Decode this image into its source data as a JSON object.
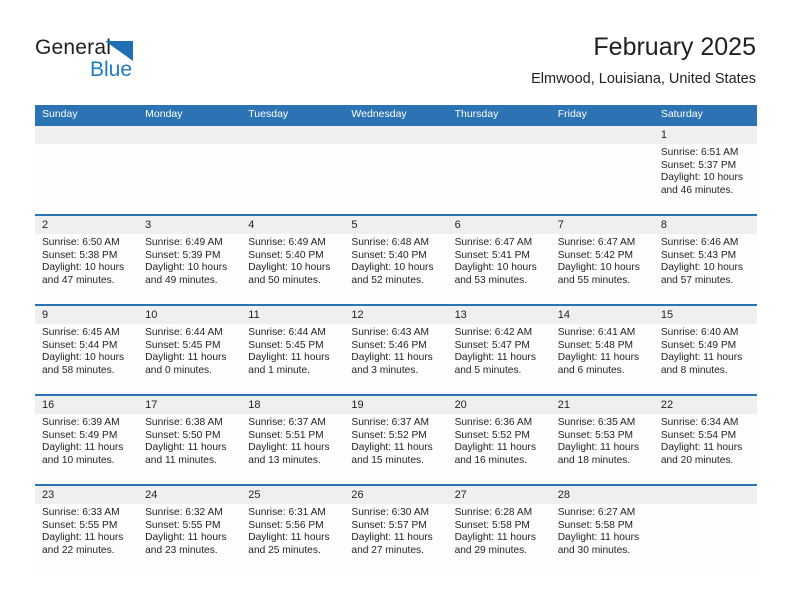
{
  "logo": {
    "word_one": "General",
    "word_two": "Blue",
    "triangle_color": "#1f6fb5",
    "blue_color": "#1f7bc1"
  },
  "header": {
    "title": "February 2025",
    "subtitle": "Elmwood, Louisiana, United States",
    "accent_color": "#2c73b4"
  },
  "calendar": {
    "weekdays": [
      "Sunday",
      "Monday",
      "Tuesday",
      "Wednesday",
      "Thursday",
      "Friday",
      "Saturday"
    ],
    "weeks": [
      [
        {
          "day": "",
          "sunrise": "",
          "sunset": "",
          "daylight": "",
          "empty": true
        },
        {
          "day": "",
          "sunrise": "",
          "sunset": "",
          "daylight": "",
          "empty": true
        },
        {
          "day": "",
          "sunrise": "",
          "sunset": "",
          "daylight": "",
          "empty": true
        },
        {
          "day": "",
          "sunrise": "",
          "sunset": "",
          "daylight": "",
          "empty": true
        },
        {
          "day": "",
          "sunrise": "",
          "sunset": "",
          "daylight": "",
          "empty": true
        },
        {
          "day": "",
          "sunrise": "",
          "sunset": "",
          "daylight": "",
          "empty": true
        },
        {
          "day": "1",
          "sunrise": "Sunrise: 6:51 AM",
          "sunset": "Sunset: 5:37 PM",
          "daylight": "Daylight: 10 hours and 46 minutes.",
          "empty": false
        }
      ],
      [
        {
          "day": "2",
          "sunrise": "Sunrise: 6:50 AM",
          "sunset": "Sunset: 5:38 PM",
          "daylight": "Daylight: 10 hours and 47 minutes.",
          "empty": false
        },
        {
          "day": "3",
          "sunrise": "Sunrise: 6:49 AM",
          "sunset": "Sunset: 5:39 PM",
          "daylight": "Daylight: 10 hours and 49 minutes.",
          "empty": false
        },
        {
          "day": "4",
          "sunrise": "Sunrise: 6:49 AM",
          "sunset": "Sunset: 5:40 PM",
          "daylight": "Daylight: 10 hours and 50 minutes.",
          "empty": false
        },
        {
          "day": "5",
          "sunrise": "Sunrise: 6:48 AM",
          "sunset": "Sunset: 5:40 PM",
          "daylight": "Daylight: 10 hours and 52 minutes.",
          "empty": false
        },
        {
          "day": "6",
          "sunrise": "Sunrise: 6:47 AM",
          "sunset": "Sunset: 5:41 PM",
          "daylight": "Daylight: 10 hours and 53 minutes.",
          "empty": false
        },
        {
          "day": "7",
          "sunrise": "Sunrise: 6:47 AM",
          "sunset": "Sunset: 5:42 PM",
          "daylight": "Daylight: 10 hours and 55 minutes.",
          "empty": false
        },
        {
          "day": "8",
          "sunrise": "Sunrise: 6:46 AM",
          "sunset": "Sunset: 5:43 PM",
          "daylight": "Daylight: 10 hours and 57 minutes.",
          "empty": false
        }
      ],
      [
        {
          "day": "9",
          "sunrise": "Sunrise: 6:45 AM",
          "sunset": "Sunset: 5:44 PM",
          "daylight": "Daylight: 10 hours and 58 minutes.",
          "empty": false
        },
        {
          "day": "10",
          "sunrise": "Sunrise: 6:44 AM",
          "sunset": "Sunset: 5:45 PM",
          "daylight": "Daylight: 11 hours and 0 minutes.",
          "empty": false
        },
        {
          "day": "11",
          "sunrise": "Sunrise: 6:44 AM",
          "sunset": "Sunset: 5:45 PM",
          "daylight": "Daylight: 11 hours and 1 minute.",
          "empty": false
        },
        {
          "day": "12",
          "sunrise": "Sunrise: 6:43 AM",
          "sunset": "Sunset: 5:46 PM",
          "daylight": "Daylight: 11 hours and 3 minutes.",
          "empty": false
        },
        {
          "day": "13",
          "sunrise": "Sunrise: 6:42 AM",
          "sunset": "Sunset: 5:47 PM",
          "daylight": "Daylight: 11 hours and 5 minutes.",
          "empty": false
        },
        {
          "day": "14",
          "sunrise": "Sunrise: 6:41 AM",
          "sunset": "Sunset: 5:48 PM",
          "daylight": "Daylight: 11 hours and 6 minutes.",
          "empty": false
        },
        {
          "day": "15",
          "sunrise": "Sunrise: 6:40 AM",
          "sunset": "Sunset: 5:49 PM",
          "daylight": "Daylight: 11 hours and 8 minutes.",
          "empty": false
        }
      ],
      [
        {
          "day": "16",
          "sunrise": "Sunrise: 6:39 AM",
          "sunset": "Sunset: 5:49 PM",
          "daylight": "Daylight: 11 hours and 10 minutes.",
          "empty": false
        },
        {
          "day": "17",
          "sunrise": "Sunrise: 6:38 AM",
          "sunset": "Sunset: 5:50 PM",
          "daylight": "Daylight: 11 hours and 11 minutes.",
          "empty": false
        },
        {
          "day": "18",
          "sunrise": "Sunrise: 6:37 AM",
          "sunset": "Sunset: 5:51 PM",
          "daylight": "Daylight: 11 hours and 13 minutes.",
          "empty": false
        },
        {
          "day": "19",
          "sunrise": "Sunrise: 6:37 AM",
          "sunset": "Sunset: 5:52 PM",
          "daylight": "Daylight: 11 hours and 15 minutes.",
          "empty": false
        },
        {
          "day": "20",
          "sunrise": "Sunrise: 6:36 AM",
          "sunset": "Sunset: 5:52 PM",
          "daylight": "Daylight: 11 hours and 16 minutes.",
          "empty": false
        },
        {
          "day": "21",
          "sunrise": "Sunrise: 6:35 AM",
          "sunset": "Sunset: 5:53 PM",
          "daylight": "Daylight: 11 hours and 18 minutes.",
          "empty": false
        },
        {
          "day": "22",
          "sunrise": "Sunrise: 6:34 AM",
          "sunset": "Sunset: 5:54 PM",
          "daylight": "Daylight: 11 hours and 20 minutes.",
          "empty": false
        }
      ],
      [
        {
          "day": "23",
          "sunrise": "Sunrise: 6:33 AM",
          "sunset": "Sunset: 5:55 PM",
          "daylight": "Daylight: 11 hours and 22 minutes.",
          "empty": false
        },
        {
          "day": "24",
          "sunrise": "Sunrise: 6:32 AM",
          "sunset": "Sunset: 5:55 PM",
          "daylight": "Daylight: 11 hours and 23 minutes.",
          "empty": false
        },
        {
          "day": "25",
          "sunrise": "Sunrise: 6:31 AM",
          "sunset": "Sunset: 5:56 PM",
          "daylight": "Daylight: 11 hours and 25 minutes.",
          "empty": false
        },
        {
          "day": "26",
          "sunrise": "Sunrise: 6:30 AM",
          "sunset": "Sunset: 5:57 PM",
          "daylight": "Daylight: 11 hours and 27 minutes.",
          "empty": false
        },
        {
          "day": "27",
          "sunrise": "Sunrise: 6:28 AM",
          "sunset": "Sunset: 5:58 PM",
          "daylight": "Daylight: 11 hours and 29 minutes.",
          "empty": false
        },
        {
          "day": "28",
          "sunrise": "Sunrise: 6:27 AM",
          "sunset": "Sunset: 5:58 PM",
          "daylight": "Daylight: 11 hours and 30 minutes.",
          "empty": false
        },
        {
          "day": "",
          "sunrise": "",
          "sunset": "",
          "daylight": "",
          "empty": true
        }
      ]
    ]
  }
}
